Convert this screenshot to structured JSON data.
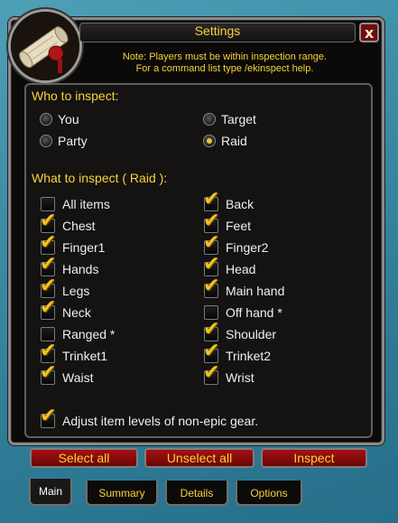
{
  "window": {
    "title": "Settings",
    "close_label": "x"
  },
  "note": {
    "line1": "Note: Players must be within inspection range.",
    "line2": "For a command list type /ekinspect help."
  },
  "who": {
    "heading": "Who to inspect:",
    "options": [
      {
        "label": "You",
        "selected": false
      },
      {
        "label": "Target",
        "selected": false
      },
      {
        "label": "Party",
        "selected": false
      },
      {
        "label": "Raid",
        "selected": true
      }
    ]
  },
  "what": {
    "heading": "What to inspect ( Raid ):",
    "items": [
      {
        "label": "All items",
        "checked": false
      },
      {
        "label": "Back",
        "checked": true
      },
      {
        "label": "Chest",
        "checked": true
      },
      {
        "label": "Feet",
        "checked": true
      },
      {
        "label": "Finger1",
        "checked": true
      },
      {
        "label": "Finger2",
        "checked": true
      },
      {
        "label": "Hands",
        "checked": true
      },
      {
        "label": "Head",
        "checked": true
      },
      {
        "label": "Legs",
        "checked": true
      },
      {
        "label": "Main hand",
        "checked": true
      },
      {
        "label": "Neck",
        "checked": true
      },
      {
        "label": "Off hand *",
        "checked": false
      },
      {
        "label": "Ranged *",
        "checked": false
      },
      {
        "label": "Shoulder",
        "checked": true
      },
      {
        "label": "Trinket1",
        "checked": true
      },
      {
        "label": "Trinket2",
        "checked": true
      },
      {
        "label": "Waist",
        "checked": true
      },
      {
        "label": "Wrist",
        "checked": true
      }
    ],
    "adjust": {
      "label": "Adjust item levels of non-epic gear.",
      "checked": true
    }
  },
  "buttons": {
    "select_all": "Select all",
    "unselect_all": "Unselect all",
    "inspect": "Inspect"
  },
  "tabs": [
    {
      "label": "Main",
      "active": true
    },
    {
      "label": "Summary",
      "active": false
    },
    {
      "label": "Details",
      "active": false
    },
    {
      "label": "Options",
      "active": false
    }
  ],
  "colors": {
    "gold_text": "#f8d23a",
    "button_red": "#8b0a0a",
    "check_gold": "#f2c21d"
  },
  "icons": {
    "portrait": "scroll-icon",
    "close": "close-icon"
  }
}
